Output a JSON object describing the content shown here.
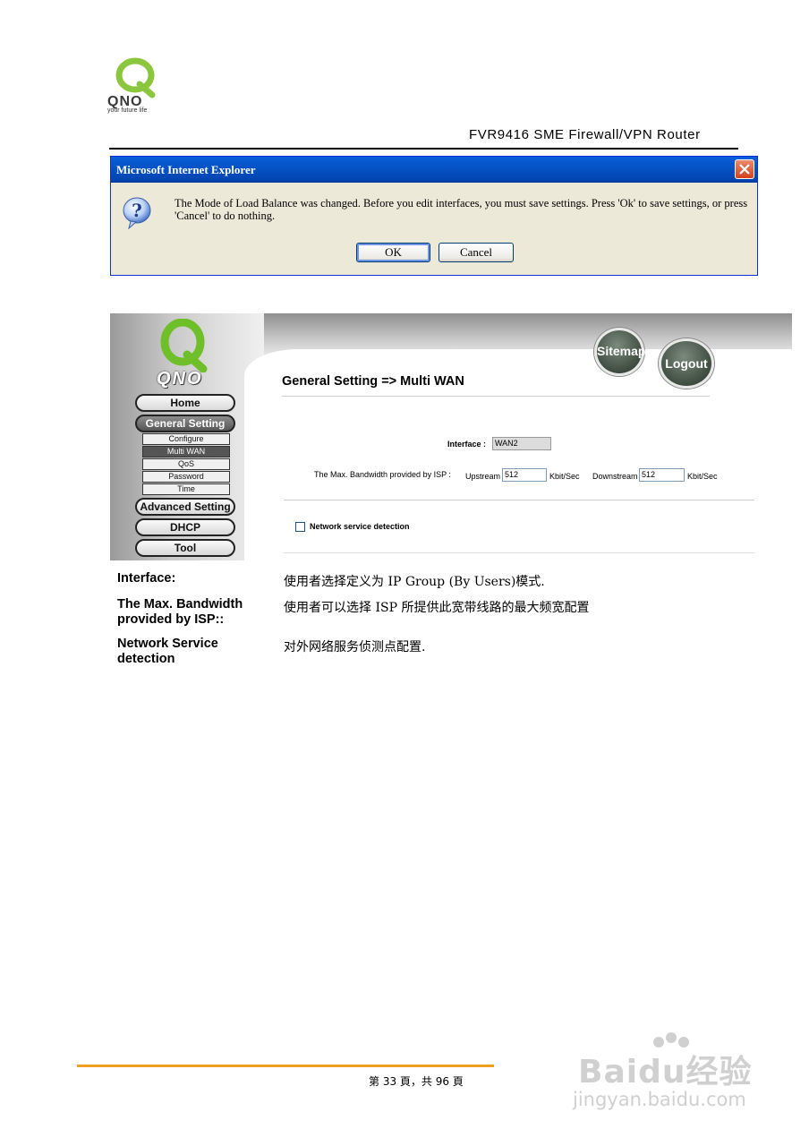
{
  "header": {
    "logo_text": "QNO",
    "logo_tagline": "your future life",
    "doc_title": "FVR9416 SME Firewall/VPN Router"
  },
  "dialog": {
    "title": "Microsoft Internet Explorer",
    "message": "The Mode of Load Balance was changed. Before you edit interfaces, you must save settings. Press 'Ok' to save settings, or press 'Cancel' to do nothing.",
    "ok_label": "OK",
    "cancel_label": "Cancel"
  },
  "router": {
    "logo_text": "QNO",
    "sitemap_label": "Sitemap",
    "logout_label": "Logout",
    "heading": "General Setting => Multi WAN",
    "nav": {
      "home": "Home",
      "general_setting": "General Setting",
      "sub": [
        "Configure",
        "Multi WAN",
        "QoS",
        "Password",
        "Time"
      ],
      "advanced_setting": "Advanced Setting",
      "dhcp": "DHCP",
      "tool": "Tool"
    },
    "form": {
      "interface_label": "Interface :",
      "interface_value": "WAN2",
      "bandwidth_label": "The Max. Bandwidth provided by ISP :",
      "upstream_label": "Upstream",
      "upstream_value": "512",
      "upstream_unit": "Kbit/Sec",
      "downstream_label": "Downstream",
      "downstream_value": "512",
      "downstream_unit": "Kbit/Sec",
      "detection_label": "Network service detection"
    }
  },
  "descriptions": [
    {
      "label": "Interface:",
      "text": "使用者选择定义为 IP Group (By Users)模式."
    },
    {
      "label": "The Max. Bandwidth provided by ISP::",
      "text": "使用者可以选择 ISP 所提供此宽带线路的最大频宽配置"
    },
    {
      "label": "Network Service detection",
      "text": "对外网络服务侦测点配置."
    }
  ],
  "footer": {
    "page_number": "第 33 頁，共 96 頁"
  },
  "watermark": {
    "brand": "Baidu经验",
    "url": "jingyan.baidu.com"
  }
}
